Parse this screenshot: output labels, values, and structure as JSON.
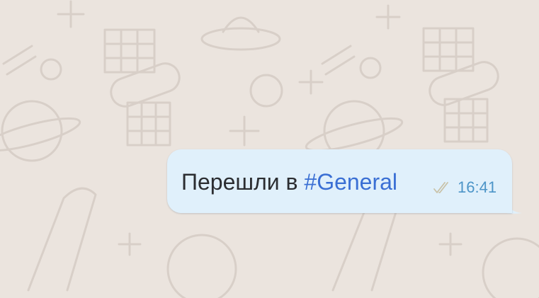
{
  "chat": {
    "background_color": "#ebe4de",
    "wallpaper": "space-doodle-pattern"
  },
  "message": {
    "direction": "outgoing",
    "text": "Перешли в ",
    "hashtag": "#General",
    "time": "16:41",
    "status_icon": "double-check-icon",
    "bubble_color": "#e0f0fb",
    "hashtag_color": "#3a6fd4",
    "time_color": "#4d95c8"
  }
}
